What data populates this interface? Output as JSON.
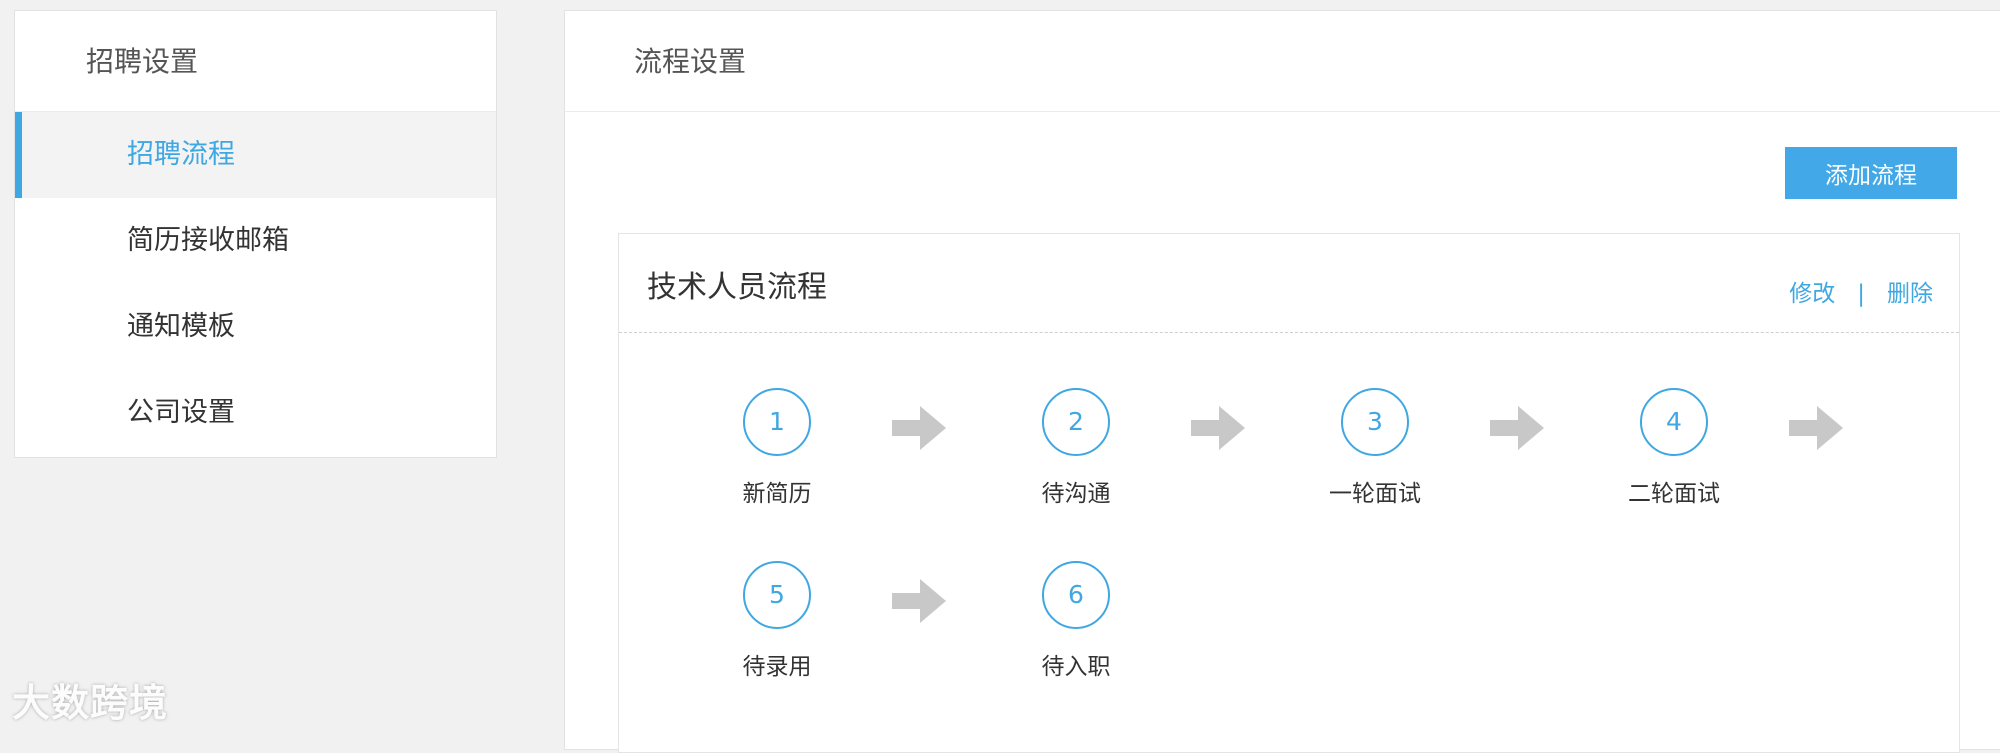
{
  "sidebar": {
    "title": "招聘设置",
    "items": [
      {
        "label": "招聘流程"
      },
      {
        "label": "简历接收邮箱"
      },
      {
        "label": "通知模板"
      },
      {
        "label": "公司设置"
      }
    ]
  },
  "main": {
    "title": "流程设置",
    "add_button": "添加流程",
    "card": {
      "title": "技术人员流程",
      "edit_label": "修改",
      "separator": "|",
      "delete_label": "删除",
      "steps": [
        {
          "num": "1",
          "label": "新简历"
        },
        {
          "num": "2",
          "label": "待沟通"
        },
        {
          "num": "3",
          "label": "一轮面试"
        },
        {
          "num": "4",
          "label": "二轮面试"
        },
        {
          "num": "5",
          "label": "待录用"
        },
        {
          "num": "6",
          "label": "待入职"
        }
      ]
    }
  },
  "watermark": "大数跨境",
  "colors": {
    "accent": "#3fa7e1",
    "button": "#42a8e8",
    "arrow": "#c8c8c8"
  }
}
